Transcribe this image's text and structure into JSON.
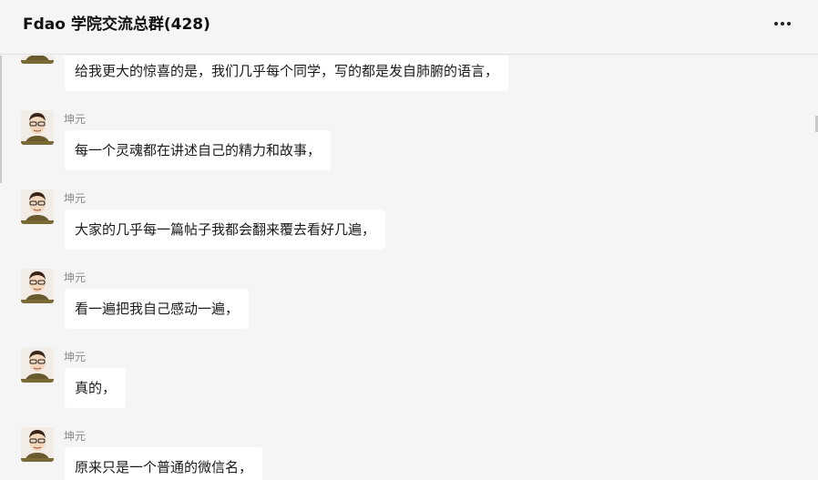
{
  "header": {
    "title": "Fdao 学院交流总群(428)",
    "more_icon": "more-horizontal-icon"
  },
  "messages": [
    {
      "sender": "",
      "text": "给我更大的惊喜的是，我们几乎每个同学，写的都是发自肺腑的语言，"
    },
    {
      "sender": "坤元",
      "text": "每一个灵魂都在讲述自己的精力和故事，"
    },
    {
      "sender": "坤元",
      "text": "大家的几乎每一篇帖子我都会翻来覆去看好几遍，"
    },
    {
      "sender": "坤元",
      "text": "看一遍把我自己感动一遍，"
    },
    {
      "sender": "坤元",
      "text": "真的，"
    },
    {
      "sender": "坤元",
      "text": "原来只是一个普通的微信名，"
    }
  ],
  "colors": {
    "background": "#f5f5f5",
    "bubble": "#ffffff",
    "sender_name": "#8a8a8a",
    "title_text": "#111111"
  }
}
